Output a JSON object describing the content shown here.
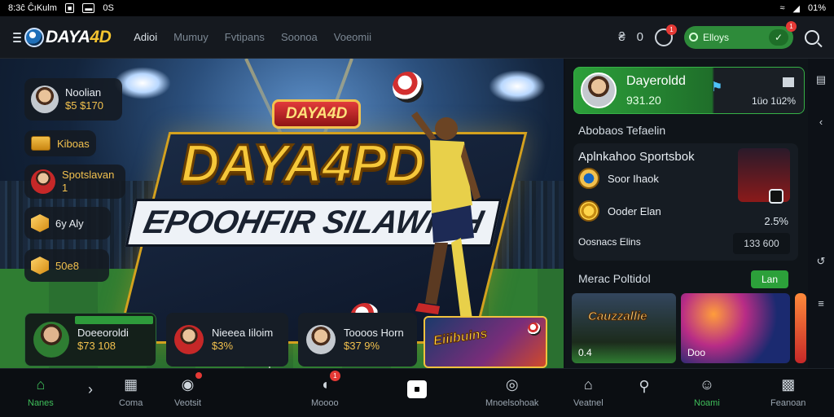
{
  "status_bar": {
    "time_text": "8:3ĉ ĈıKulm",
    "carrier": "0S",
    "battery": "01%"
  },
  "header": {
    "logo_text_a": "DAYA",
    "logo_text_b": "4D",
    "nav": [
      "Adioi",
      "Mumuy",
      "Fvtipans",
      "Soonoa",
      "Voeomii"
    ],
    "coin_amount": "0",
    "notif_count": "1",
    "pill_label": "Elloys",
    "pill_badge": "1"
  },
  "banner": {
    "badge_text": "DAYA4D",
    "title": "DAYA4PD",
    "subtitle": "EPOOHFIR SILAWINH",
    "left_cards": [
      {
        "name": "Noolian",
        "value": "$5 $170"
      },
      {
        "name": "Kiboas"
      },
      {
        "name": "Spotslavan",
        "value": "1"
      },
      {
        "name": "6y Aly"
      },
      {
        "name": "50e8"
      }
    ],
    "bottom_cards": [
      {
        "name": "Doeeoroldi",
        "value": "$73 108"
      },
      {
        "name": "Nieeea Iiloim",
        "value": "$3%"
      },
      {
        "name": "Toooos Horn",
        "value": "$37 9%"
      }
    ],
    "promo_text": "Eiiibuins"
  },
  "right_panel": {
    "user": {
      "name": "Dayeroldd",
      "balance": "931.20",
      "rate": "1üo 1ü2%"
    },
    "section_title": "Abobaos Tefaelin",
    "sports_title": "Aplnkahoo Sportsbok",
    "rows": [
      {
        "label": "Soor Ihaok"
      },
      {
        "label": "Ooder Elan",
        "percent": "2.5%"
      },
      {
        "label": "Oosnacs Elins",
        "amount": "133 600"
      }
    ],
    "games_title": "Merac Poltidol",
    "new_button": "Lan",
    "thumbs": [
      {
        "title": "Cauzzallie",
        "caption": "0.4"
      },
      {
        "caption": "Doo"
      }
    ]
  },
  "bottom_nav": [
    {
      "label": "Nanes",
      "icon": "home-icon",
      "active": true
    },
    {
      "label": "",
      "icon": "arrow-icon"
    },
    {
      "label": "Coma",
      "icon": "card-icon"
    },
    {
      "label": "Veotsit",
      "icon": "flame-icon",
      "badge": true
    },
    {
      "label": "Moooo",
      "icon": "chat-icon",
      "badge": "1"
    },
    {
      "label": "Mnoelsohoak",
      "icon": "gift-icon"
    },
    {
      "label": "Veatnel",
      "icon": "house-icon"
    },
    {
      "label": "",
      "icon": "search-icon"
    },
    {
      "label": "Noami",
      "icon": "user-icon",
      "active": true
    },
    {
      "label": "Feanoan",
      "icon": "inbox-icon"
    }
  ],
  "colors": {
    "accent": "#2ca03a",
    "gold": "#f2c14e",
    "background": "#0d1117"
  }
}
